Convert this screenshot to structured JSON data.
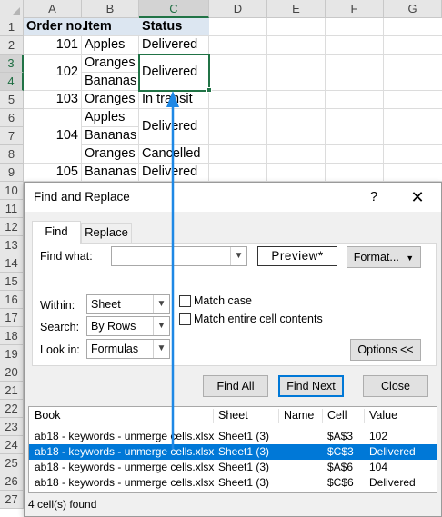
{
  "columns": [
    "A",
    "B",
    "C",
    "D",
    "E",
    "F",
    "G"
  ],
  "rows": [
    "1",
    "2",
    "3",
    "4",
    "5",
    "6",
    "7",
    "8",
    "9",
    "10",
    "11",
    "12",
    "13",
    "14",
    "15",
    "16",
    "17",
    "18",
    "19",
    "20",
    "21",
    "22",
    "23",
    "24",
    "25",
    "26",
    "27"
  ],
  "cells": {
    "a1": "Order no.",
    "b1": "Item",
    "c1": "Status",
    "a2": "101",
    "b2": "Apples",
    "c2": "Delivered",
    "a3": "102",
    "b3": "Oranges",
    "c3": "Delivered",
    "b4": "Bananas",
    "a5": "103",
    "b5": "Oranges",
    "c5": "In transit",
    "a6": "104",
    "b6": "Apples",
    "c6": "Delivered",
    "b7": "Bananas",
    "b8": "Oranges",
    "c8": "Cancelled",
    "a9": "105",
    "b9": "Bananas",
    "c9": "Delivered"
  },
  "dialog": {
    "title": "Find and Replace",
    "help": "?",
    "close": "✕",
    "tabs": {
      "find": "Find",
      "replace": "Replace"
    },
    "find_what_label": "Find what:",
    "find_what_value": "",
    "preview": "Preview*",
    "format_button": "Format...",
    "within_label": "Within:",
    "within_value": "Sheet",
    "search_label": "Search:",
    "search_value": "By Rows",
    "lookin_label": "Look in:",
    "lookin_value": "Formulas",
    "match_case": "Match case",
    "match_entire": "Match entire cell contents",
    "options_button": "Options <<",
    "find_all": "Find All",
    "find_next": "Find Next",
    "close_button": "Close",
    "results": {
      "headers": [
        "Book",
        "Sheet",
        "Name",
        "Cell",
        "Value"
      ],
      "rows": [
        [
          "ab18 - keywords - unmerge cells.xlsx",
          "Sheet1 (3)",
          "",
          "$A$3",
          "102"
        ],
        [
          "ab18 - keywords - unmerge cells.xlsx",
          "Sheet1 (3)",
          "",
          "$C$3",
          "Delivered"
        ],
        [
          "ab18 - keywords - unmerge cells.xlsx",
          "Sheet1 (3)",
          "",
          "$A$6",
          "104"
        ],
        [
          "ab18 - keywords - unmerge cells.xlsx",
          "Sheet1 (3)",
          "",
          "$C$6",
          "Delivered"
        ]
      ],
      "selected_row": 1
    },
    "status": "4 cell(s) found"
  },
  "colors": {
    "accent_green": "#217346",
    "selection_blue": "#0078d7",
    "header_fill": "#dce6f1",
    "arrow_blue": "#1e88e5"
  }
}
